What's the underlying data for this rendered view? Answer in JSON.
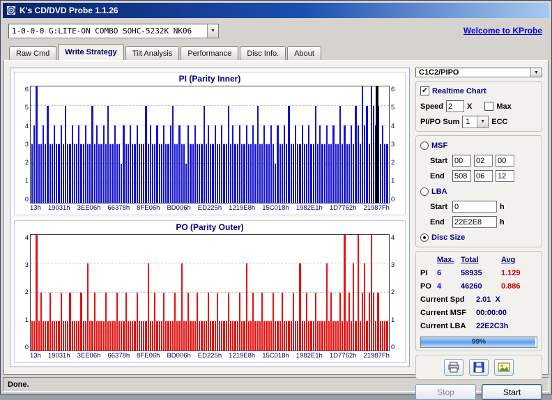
{
  "window": {
    "title": "K's CD/DVD Probe 1.1.26",
    "status": "Done."
  },
  "toolbar": {
    "device": "1-0-0-0 G:LITE-ON COMBO SOHC-5232K NK06",
    "welcome_link": "Welcome to KProbe"
  },
  "tabs": [
    {
      "label": "Raw Cmd"
    },
    {
      "label": "Write Strategy"
    },
    {
      "label": "Tilt Analysis"
    },
    {
      "label": "Performance"
    },
    {
      "label": "Disc Info."
    },
    {
      "label": "About"
    }
  ],
  "icons": {
    "dropdown": "▼",
    "check": "✓",
    "print": "printer-icon",
    "save": "floppy-icon",
    "export": "chart-image-icon"
  },
  "controls": {
    "mode_select": "C1C2/PIPO",
    "realtime_label": "Realtime Chart",
    "speed_label": "Speed",
    "speed_value": "2",
    "speed_unit": "X",
    "max_label": "Max",
    "pipo_sum_label": "PI/PO Sum",
    "pipo_sum_value": "1",
    "ecc_label": "ECC",
    "msf": {
      "label": "MSF",
      "start_label": "Start",
      "end_label": "End",
      "start": [
        "00",
        "02",
        "00"
      ],
      "end": [
        "508",
        "06",
        "12"
      ]
    },
    "lba": {
      "label": "LBA",
      "start_label": "Start",
      "end_label": "End",
      "start": "0",
      "end": "22E2E8",
      "unit": "h"
    },
    "disc_size_label": "Disc Size"
  },
  "stats": {
    "headers": [
      "Max.",
      "Total",
      "Avg"
    ],
    "rows": [
      {
        "label": "PI",
        "max": "6",
        "total": "58935",
        "avg": "1.129"
      },
      {
        "label": "PO",
        "max": "4",
        "total": "46260",
        "avg": "0.886"
      }
    ],
    "current_spd_label": "Current Spd",
    "current_spd": "2.01",
    "current_spd_unit": "X",
    "current_msf_label": "Current MSF",
    "current_msf": "00:00:00",
    "current_lba_label": "Current LBA",
    "current_lba": "22E2C3h",
    "progress": "99%",
    "progress_value": 99
  },
  "actions": {
    "stop_label": "Stop",
    "start_label": "Start"
  },
  "colors": {
    "titlebar_start": "#0a246a",
    "titlebar_end": "#a6caf0",
    "pi_bar": "#1414cc",
    "po_bar": "#e81010",
    "navy": "#000080",
    "link": "#0000d6"
  },
  "chart_data": [
    {
      "id": "pi",
      "type": "bar",
      "title": "PI (Parity Inner)",
      "ylabel": "",
      "xlabel": "",
      "ylim": [
        0,
        6
      ],
      "ymax": 6,
      "grid": true,
      "legend": "none",
      "color": "#1414cc",
      "cursor_pos": 0.963,
      "categories": [
        "13h",
        "19031h",
        "3EE06h",
        "66378h",
        "8FE06h",
        "BD006h",
        "ED225h",
        "1219E8h",
        "15C018h",
        "1982E1h",
        "1D7762h",
        "21987Fh"
      ],
      "values": [
        3,
        4,
        6,
        3,
        3,
        4,
        3,
        5,
        3,
        3,
        4,
        3,
        3,
        4,
        3,
        5,
        3,
        3,
        4,
        3,
        3,
        4,
        3,
        3,
        4,
        3,
        3,
        5,
        3,
        4,
        3,
        3,
        4,
        3,
        5,
        3,
        3,
        4,
        3,
        3,
        2,
        4,
        3,
        3,
        4,
        3,
        3,
        4,
        3,
        3,
        3,
        5,
        3,
        4,
        3,
        3,
        4,
        3,
        3,
        4,
        3,
        3,
        4,
        5,
        3,
        3,
        4,
        3,
        3,
        2,
        4,
        3,
        3,
        4,
        3,
        3,
        3,
        5,
        3,
        4,
        3,
        3,
        4,
        3,
        3,
        4,
        3,
        3,
        5,
        3,
        4,
        3,
        3,
        4,
        3,
        3,
        4,
        3,
        3,
        4,
        3,
        5,
        3,
        3,
        4,
        3,
        3,
        4,
        3,
        2,
        4,
        3,
        3,
        4,
        3,
        5,
        3,
        3,
        4,
        3,
        3,
        4,
        3,
        3,
        4,
        3,
        3,
        5,
        3,
        4,
        3,
        3,
        4,
        3,
        3,
        4,
        3,
        3,
        5,
        3,
        4,
        3,
        3,
        4,
        3,
        5,
        4,
        3,
        6,
        4,
        5,
        3,
        6,
        5,
        4,
        5,
        3,
        4,
        3,
        3
      ]
    },
    {
      "id": "po",
      "type": "bar",
      "title": "PO (Parity Outer)",
      "ylabel": "",
      "xlabel": "",
      "ylim": [
        0,
        4
      ],
      "ymax": 4,
      "grid": true,
      "legend": "none",
      "color": "#e81010",
      "categories": [
        "13h",
        "19031h",
        "3EE06h",
        "66378h",
        "8FE06h",
        "BD006h",
        "ED225h",
        "1219E8h",
        "15C018h",
        "1982E1h",
        "1D7762h",
        "21987Fh"
      ],
      "values": [
        1,
        1,
        4,
        1,
        2,
        1,
        1,
        1,
        2,
        1,
        1,
        1,
        1,
        2,
        1,
        1,
        1,
        2,
        1,
        1,
        1,
        1,
        2,
        1,
        1,
        3,
        1,
        1,
        2,
        1,
        1,
        1,
        1,
        2,
        1,
        1,
        1,
        1,
        2,
        1,
        1,
        1,
        2,
        1,
        1,
        1,
        1,
        2,
        1,
        1,
        1,
        1,
        3,
        1,
        1,
        2,
        1,
        1,
        1,
        2,
        1,
        1,
        1,
        1,
        2,
        1,
        1,
        3,
        1,
        1,
        2,
        1,
        1,
        1,
        2,
        1,
        1,
        1,
        1,
        2,
        1,
        1,
        1,
        2,
        1,
        1,
        1,
        1,
        2,
        1,
        1,
        1,
        1,
        2,
        1,
        1,
        3,
        1,
        1,
        2,
        1,
        1,
        1,
        2,
        1,
        1,
        1,
        1,
        2,
        1,
        1,
        1,
        2,
        1,
        1,
        1,
        1,
        2,
        1,
        1,
        3,
        1,
        1,
        2,
        1,
        1,
        1,
        2,
        1,
        1,
        1,
        1,
        3,
        1,
        2,
        1,
        1,
        1,
        2,
        1,
        4,
        1,
        2,
        1,
        3,
        1,
        4,
        1,
        2,
        3,
        1,
        2,
        4,
        2,
        1,
        2,
        1,
        1,
        1,
        1
      ]
    }
  ]
}
